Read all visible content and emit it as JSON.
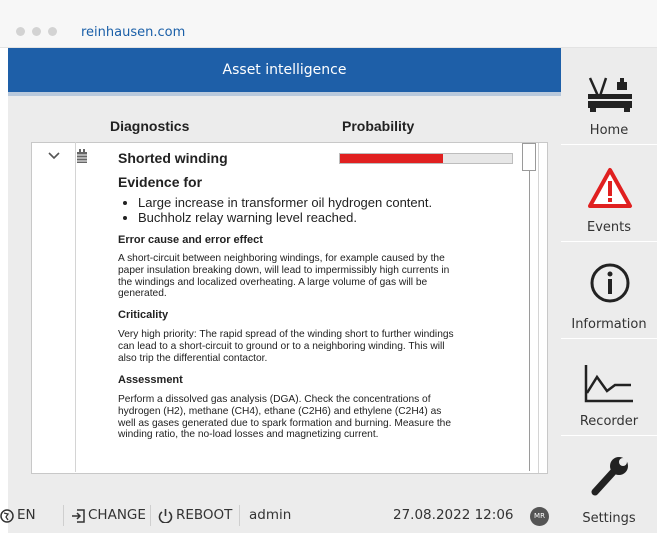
{
  "browser": {
    "url": "reinhausen.com"
  },
  "header": {
    "title": "Asset intelligence"
  },
  "columns": {
    "diagnostics": "Diagnostics",
    "probability": "Probability"
  },
  "item": {
    "title": "Shorted winding",
    "probability_fraction": 0.6,
    "evidence_heading": "Evidence for",
    "evidence": [
      "Large increase in transformer oil hydrogen content.",
      "Buchholz relay warning level reached."
    ],
    "sections": [
      {
        "heading": "Error cause and error effect",
        "text": "A short-circuit between neighboring windings, for example caused by the paper insulation breaking down, will lead to impermissibly high currents in the windings and localized overheating. A large volume of gas will be generated."
      },
      {
        "heading": "Criticality",
        "text": "Very high priority: The rapid spread of the winding short to further windings can lead to a short-circuit to ground or to a neighboring winding. This will also trip the differential contactor."
      },
      {
        "heading": "Assessment",
        "text": "Perform a dissolved gas analysis (DGA). Check the concentrations of hydrogen (H2), methane (CH4), ethane (C2H6) and ethylene (C2H4) as well as gases generated due to spark formation and burning. Measure the winding ratio, the no-load losses and magnetizing current."
      }
    ]
  },
  "sidebar": {
    "items": [
      {
        "label": "Home"
      },
      {
        "label": "Events"
      },
      {
        "label": "Information"
      },
      {
        "label": "Recorder"
      },
      {
        "label": "Settings"
      }
    ]
  },
  "status_bar": {
    "language": "EN",
    "change": "CHANGE",
    "reboot": "REBOOT",
    "user": "admin",
    "datetime": "27.08.2022 12:06",
    "logo": "MR"
  },
  "colors": {
    "brand_blue": "#1e5fa8",
    "alert_red": "#e02020"
  }
}
